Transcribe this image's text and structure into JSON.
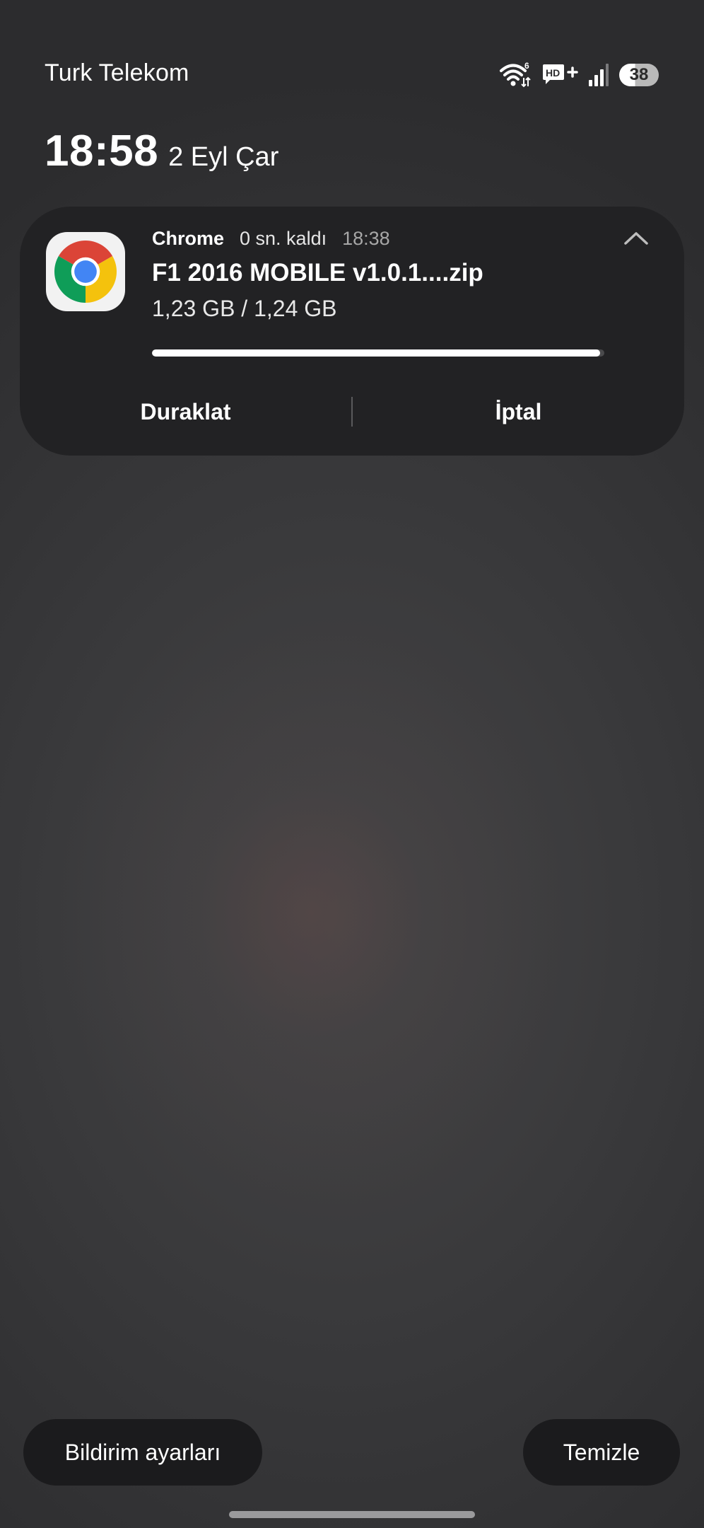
{
  "status_bar": {
    "carrier": "Turk Telekom",
    "wifi_label": "6",
    "network_label": "HD+",
    "battery_level": "38",
    "icons": [
      "wifi-icon",
      "hd-voice-icon",
      "signal-icon",
      "battery-icon"
    ]
  },
  "header": {
    "clock": "18:58",
    "date": "2 Eyl Çar"
  },
  "notification": {
    "app_name": "Chrome",
    "remaining": "0 sn. kaldı",
    "time": "18:38",
    "file_name": "F1 2016 MOBILE v1.0.1....zip",
    "file_size": "1,23 GB / 1,24 GB",
    "progress_fraction": 0.99,
    "actions": {
      "pause": "Duraklat",
      "cancel": "İptal"
    },
    "icons": [
      "chrome-icon",
      "chevron-up-icon"
    ]
  },
  "bottom": {
    "settings_label": "Bildirim ayarları",
    "clear_label": "Temizle"
  },
  "colors": {
    "card_bg": "#222224",
    "pill_bg": "#1b1b1d",
    "chrome_red": "#db4437",
    "chrome_yellow": "#f4c20d",
    "chrome_green": "#0f9d58",
    "chrome_blue": "#4285f4"
  }
}
